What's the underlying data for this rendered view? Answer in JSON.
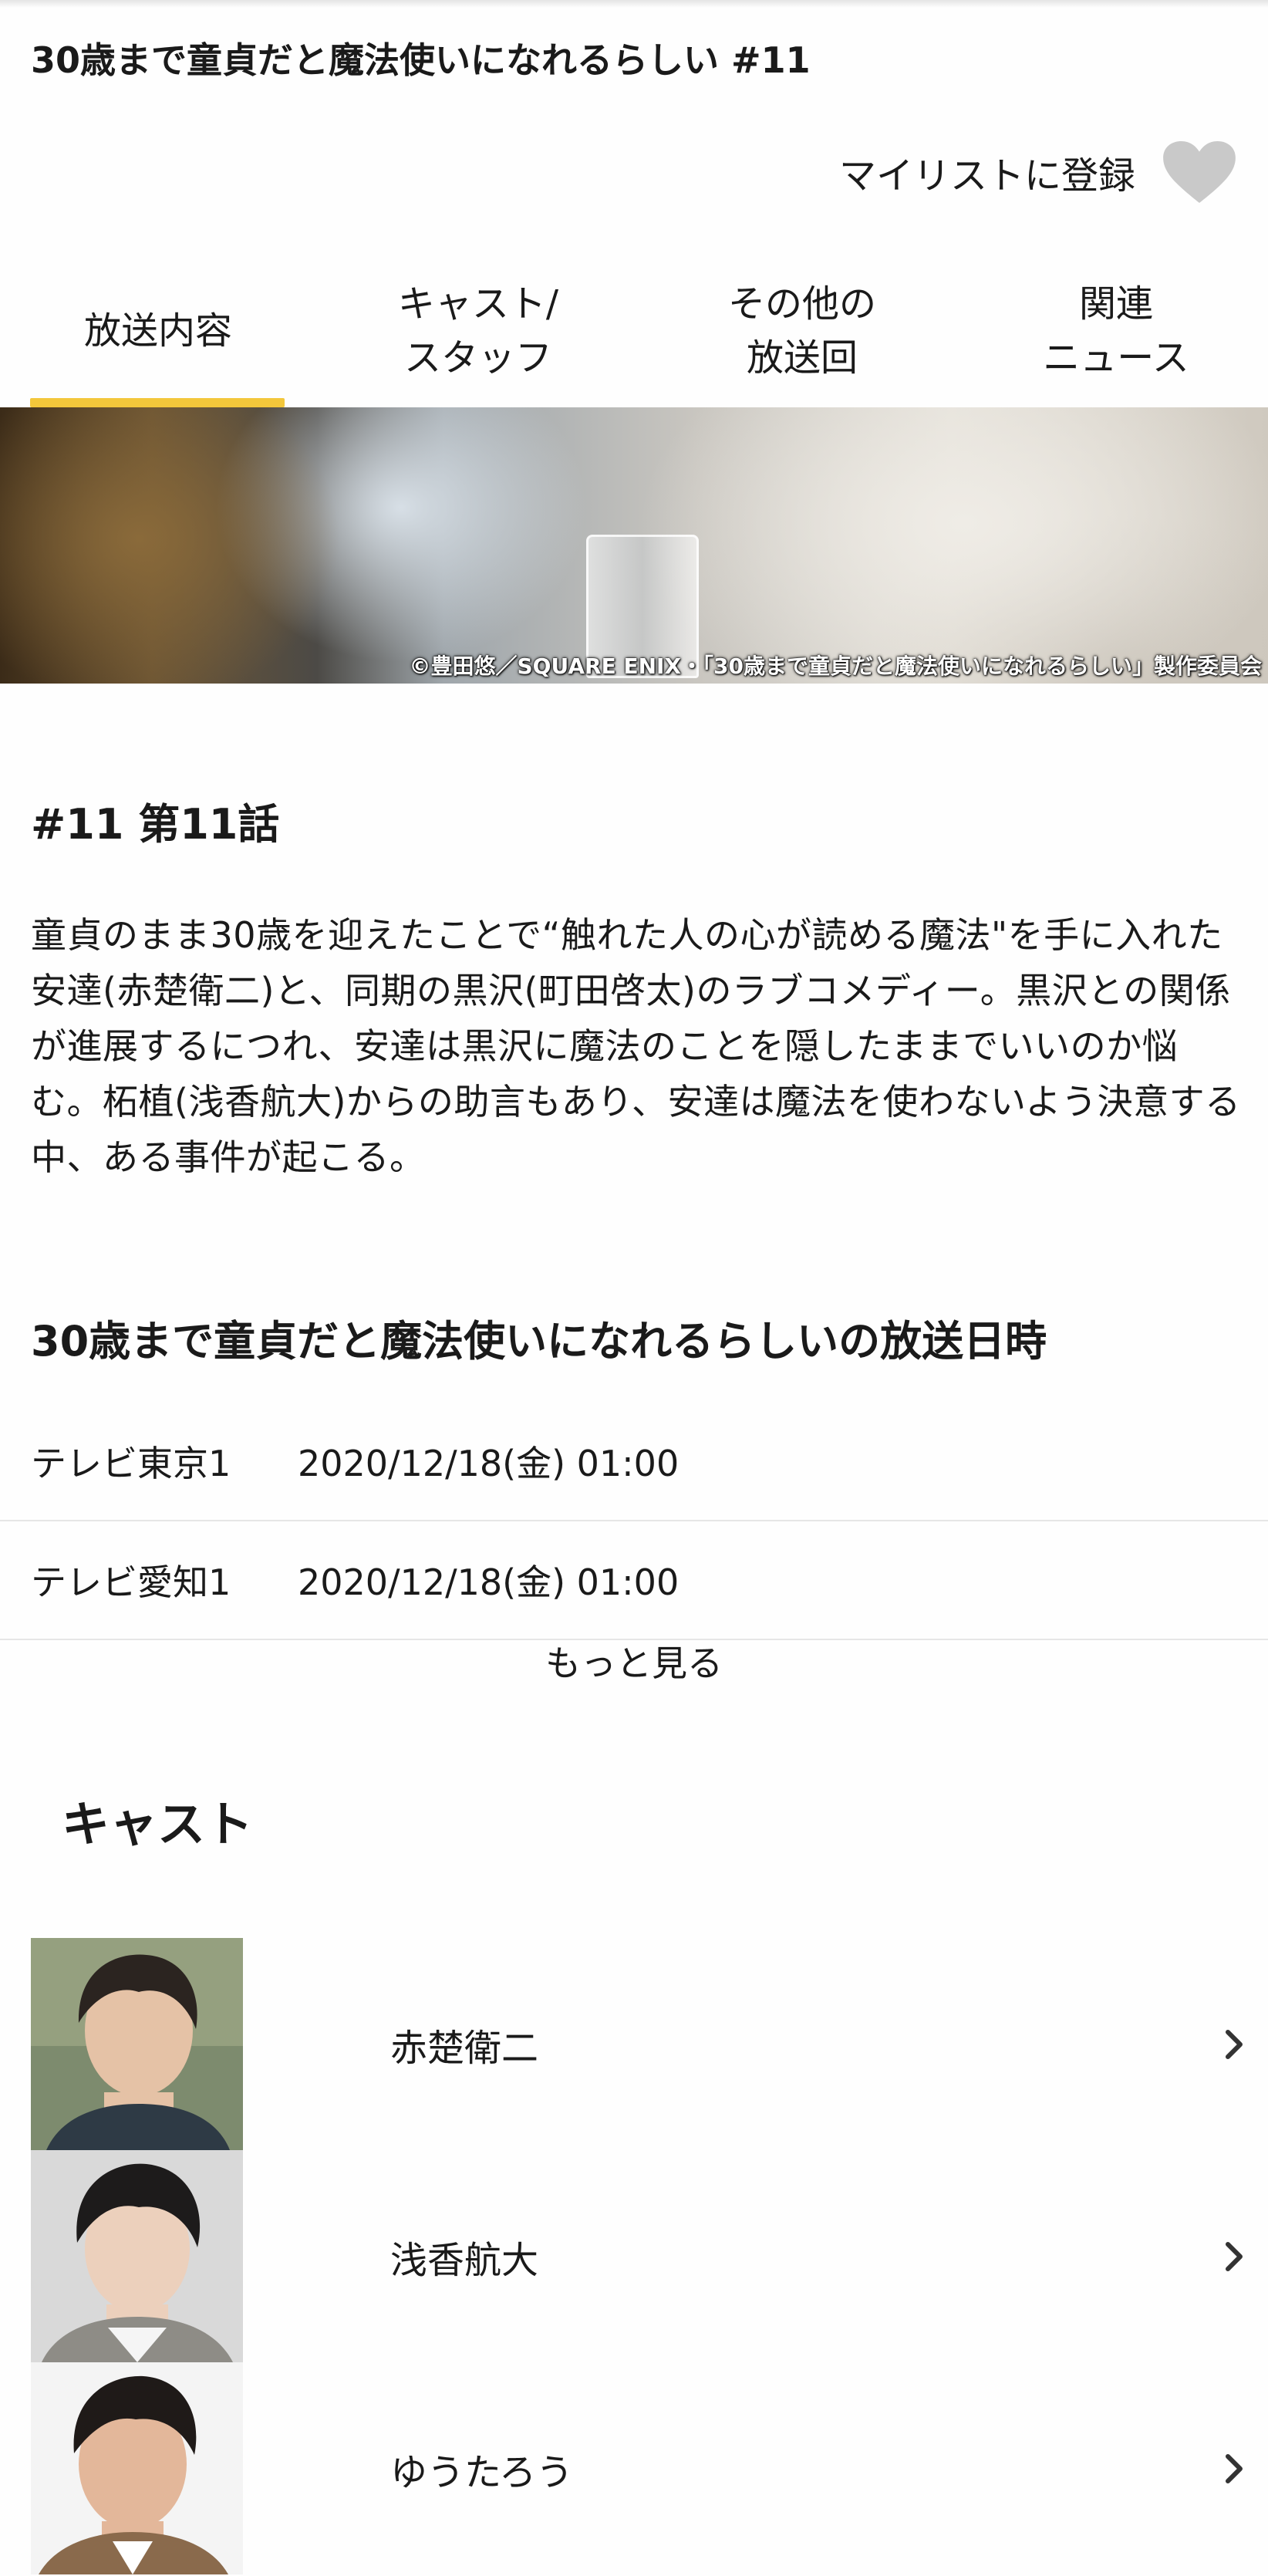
{
  "header": {
    "title": "30歳まで童貞だと魔法使いになれるらしい #11",
    "mylist_label": "マイリストに登録"
  },
  "tabs": [
    {
      "label": "放送内容",
      "active": true
    },
    {
      "label": "キャスト/\nスタッフ",
      "active": false
    },
    {
      "label": "その他の\n放送回",
      "active": false
    },
    {
      "label": "関連\nニュース",
      "active": false
    }
  ],
  "hero": {
    "credit": "©豊田悠／SQUARE ENIX・「30歳まで童貞だと魔法使いになれるらしい」製作委員会"
  },
  "episode": {
    "title": "#11 第11話",
    "synopsis": "童貞のまま30歳を迎えたことで“触れた人の心が読める魔法\"を手に入れた安達(赤楚衛二)と、同期の黒沢(町田啓太)のラブコメディー。黒沢との関係が進展するにつれ、安達は黒沢に魔法のことを隠したままでいいのか悩む。柘植(浅香航大)からの助言もあり、安達は魔法を使わないよう決意する中、ある事件が起こる。"
  },
  "broadcast": {
    "heading": "30歳まで童貞だと魔法使いになれるらしいの放送日時",
    "rows": [
      {
        "station": "テレビ東京1",
        "datetime": "2020/12/18(金) 01:00"
      },
      {
        "station": "テレビ愛知1",
        "datetime": "2020/12/18(金) 01:00"
      }
    ],
    "more_label": "もっと見る"
  },
  "cast": {
    "heading": "キャスト",
    "members": [
      {
        "name": "赤楚衛二"
      },
      {
        "name": "浅香航大"
      },
      {
        "name": "ゆうたろう"
      }
    ]
  },
  "colors": {
    "accent": "#f3c73b",
    "heart": "#c9c9c9",
    "divider": "#e6e6e6"
  }
}
